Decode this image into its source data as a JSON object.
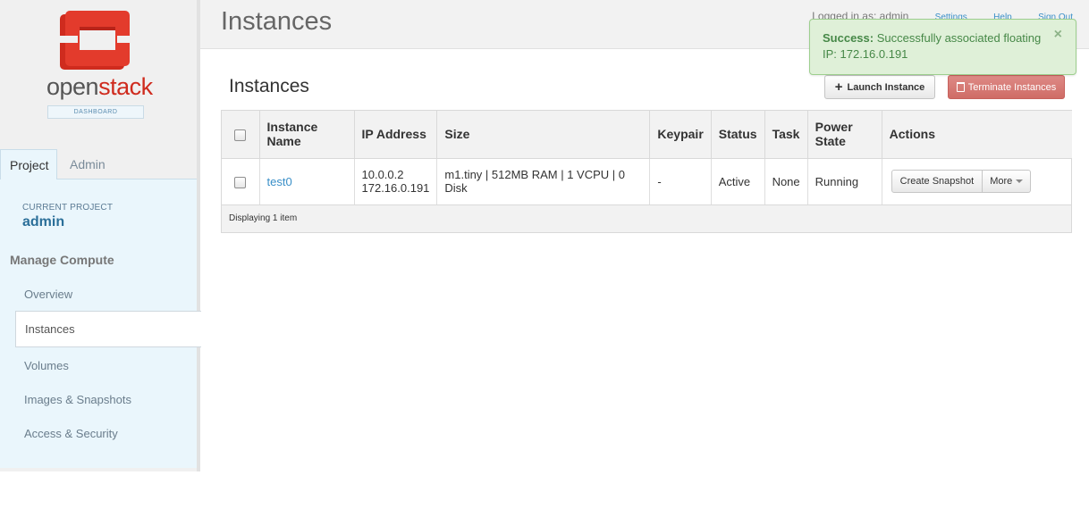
{
  "brand": {
    "open": "open",
    "stack": "stack",
    "badge": "DASHBOARD",
    "colors": {
      "red": "#cf2b1e",
      "gray": "#555555"
    }
  },
  "sidebar": {
    "tabs": [
      {
        "label": "Project",
        "active": true
      },
      {
        "label": "Admin",
        "active": false
      }
    ],
    "current_project_label": "CURRENT PROJECT",
    "current_project_value": "admin",
    "manage_heading": "Manage Compute",
    "items": [
      {
        "label": "Overview",
        "active": false
      },
      {
        "label": "Instances",
        "active": true
      },
      {
        "label": "Volumes",
        "active": false
      },
      {
        "label": "Images & Snapshots",
        "active": false
      },
      {
        "label": "Access & Security",
        "active": false
      }
    ]
  },
  "header": {
    "title": "Instances",
    "logged_in": "Logged in as: admin",
    "settings": "Settings",
    "help": "Help",
    "sign_out": "Sign Out"
  },
  "main": {
    "section_title": "Instances",
    "launch_label": "Launch Instance",
    "terminate_label": "Terminate Instances",
    "table": {
      "headers": [
        "Instance Name",
        "IP Address",
        "Size",
        "Keypair",
        "Status",
        "Task",
        "Power State",
        "Actions"
      ],
      "rows": [
        {
          "name": "test0",
          "ip1": "10.0.0.2",
          "ip2": "172.16.0.191",
          "size": "m1.tiny | 512MB RAM | 1 VCPU | 0 Disk",
          "keypair": "-",
          "status": "Active",
          "task": "None",
          "power": "Running",
          "action_primary": "Create Snapshot",
          "action_more": "More"
        }
      ],
      "footer": "Displaying 1 item"
    }
  },
  "alert": {
    "strong": "Success:",
    "message": "Successfully associated floating IP: 172.16.0.191",
    "close": "×",
    "colors": {
      "bg": "#dff0d8",
      "text": "#468847"
    }
  }
}
